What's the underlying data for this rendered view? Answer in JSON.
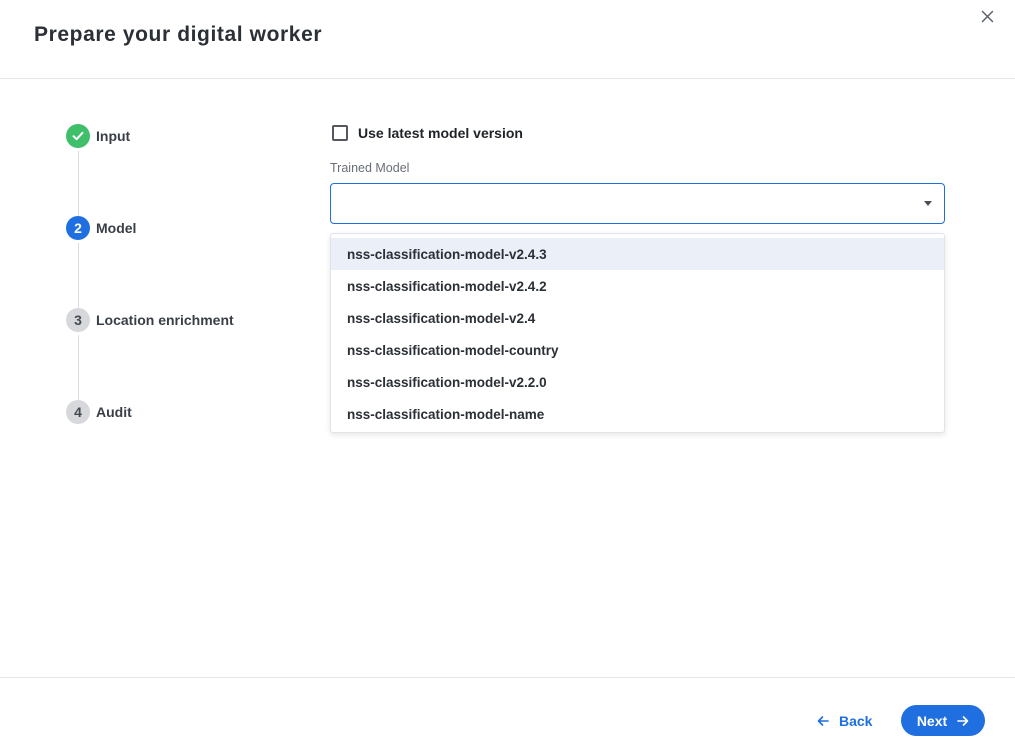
{
  "dialog": {
    "title": "Prepare your digital worker",
    "close_icon": "close-icon"
  },
  "stepper": {
    "steps": [
      {
        "number": "1",
        "label": "Input",
        "status": "done",
        "icon": "check-icon"
      },
      {
        "number": "2",
        "label": "Model",
        "status": "active"
      },
      {
        "number": "3",
        "label": "Location enrichment",
        "status": "pending"
      },
      {
        "number": "4",
        "label": "Audit",
        "status": "pending"
      }
    ]
  },
  "form": {
    "use_latest_label": "Use latest model version",
    "use_latest_checked": false,
    "trained_model_label": "Trained Model",
    "trained_model_value": "",
    "dropdown_icon": "chevron-down-icon",
    "options": [
      "nss-classification-model-v2.4.3",
      "nss-classification-model-v2.4.2",
      "nss-classification-model-v2.4",
      "nss-classification-model-country",
      "nss-classification-model-v2.2.0",
      "nss-classification-model-name"
    ],
    "highlighted_option_index": 0
  },
  "footer": {
    "back_label": "Back",
    "next_label": "Next",
    "back_icon": "arrow-left-icon",
    "next_icon": "arrow-right-icon"
  },
  "colors": {
    "primary": "#1f6fe0",
    "step_done": "#3fbf6a",
    "step_pending": "#d6d8dc",
    "highlight": "#ebeff8"
  }
}
